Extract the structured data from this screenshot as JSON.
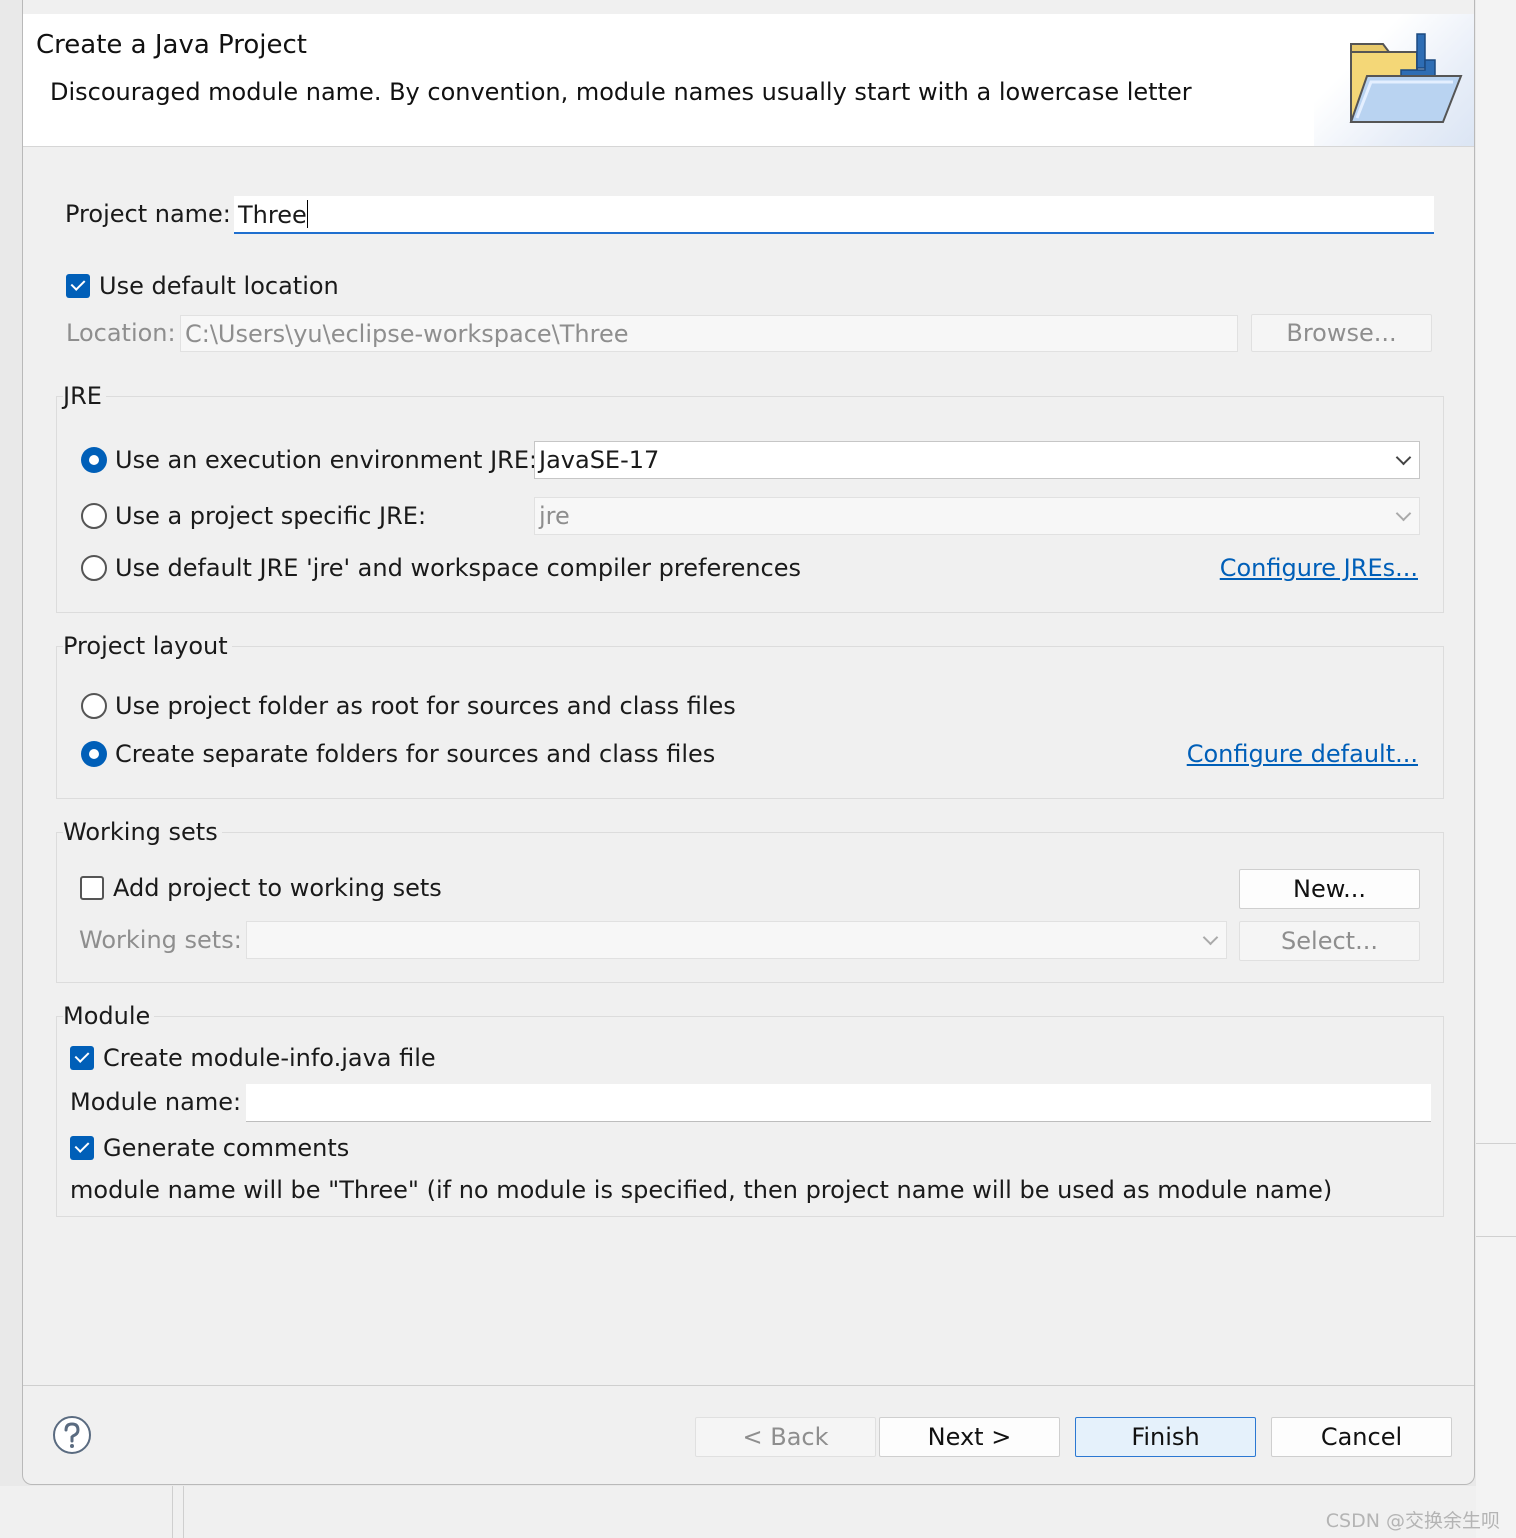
{
  "dialog": {
    "title": "Create a Java Project",
    "message": "Discouraged module name. By convention, module names usually start with a lowercase letter"
  },
  "project": {
    "name_label": "Project name:",
    "name_value": "Three",
    "use_default_location_label": "Use default location",
    "use_default_location_checked": true,
    "location_label": "Location:",
    "location_value": "C:\\Users\\yu\\eclipse-workspace\\Three",
    "browse_label": "Browse..."
  },
  "jre": {
    "group_title": "JRE",
    "option_env_label": "Use an execution environment JRE:",
    "option_env_value": "JavaSE-17",
    "option_specific_label": "Use a project specific JRE:",
    "option_specific_value": "jre",
    "option_default_label": "Use default JRE 'jre' and workspace compiler preferences",
    "configure_link": "Configure JREs...",
    "selected": "execution-environment"
  },
  "layout": {
    "group_title": "Project layout",
    "option_root_label": "Use project folder as root for sources and class files",
    "option_separate_label": "Create separate folders for sources and class files",
    "configure_link": "Configure default...",
    "selected": "separate"
  },
  "working_sets": {
    "group_title": "Working sets",
    "add_label": "Add project to working sets",
    "add_checked": false,
    "new_button": "New...",
    "sets_label": "Working sets:",
    "sets_value": "",
    "select_button": "Select..."
  },
  "module": {
    "group_title": "Module",
    "create_label": "Create module-info.java file",
    "create_checked": true,
    "name_label": "Module name:",
    "name_value": "",
    "comments_label": "Generate comments",
    "comments_checked": true,
    "info_text": "module name will be \"Three\"  (if no module is specified, then project name will be used as module name)"
  },
  "footer": {
    "back_label": "< Back",
    "next_label": "Next >",
    "finish_label": "Finish",
    "cancel_label": "Cancel"
  },
  "watermark": "CSDN @交换余生呗",
  "colors": {
    "accent": "#005fb8",
    "link": "#005fb8",
    "dialog_bg": "#f0f0f0",
    "header_bg": "#ffffff",
    "finish_bg": "#e5f1fb"
  }
}
